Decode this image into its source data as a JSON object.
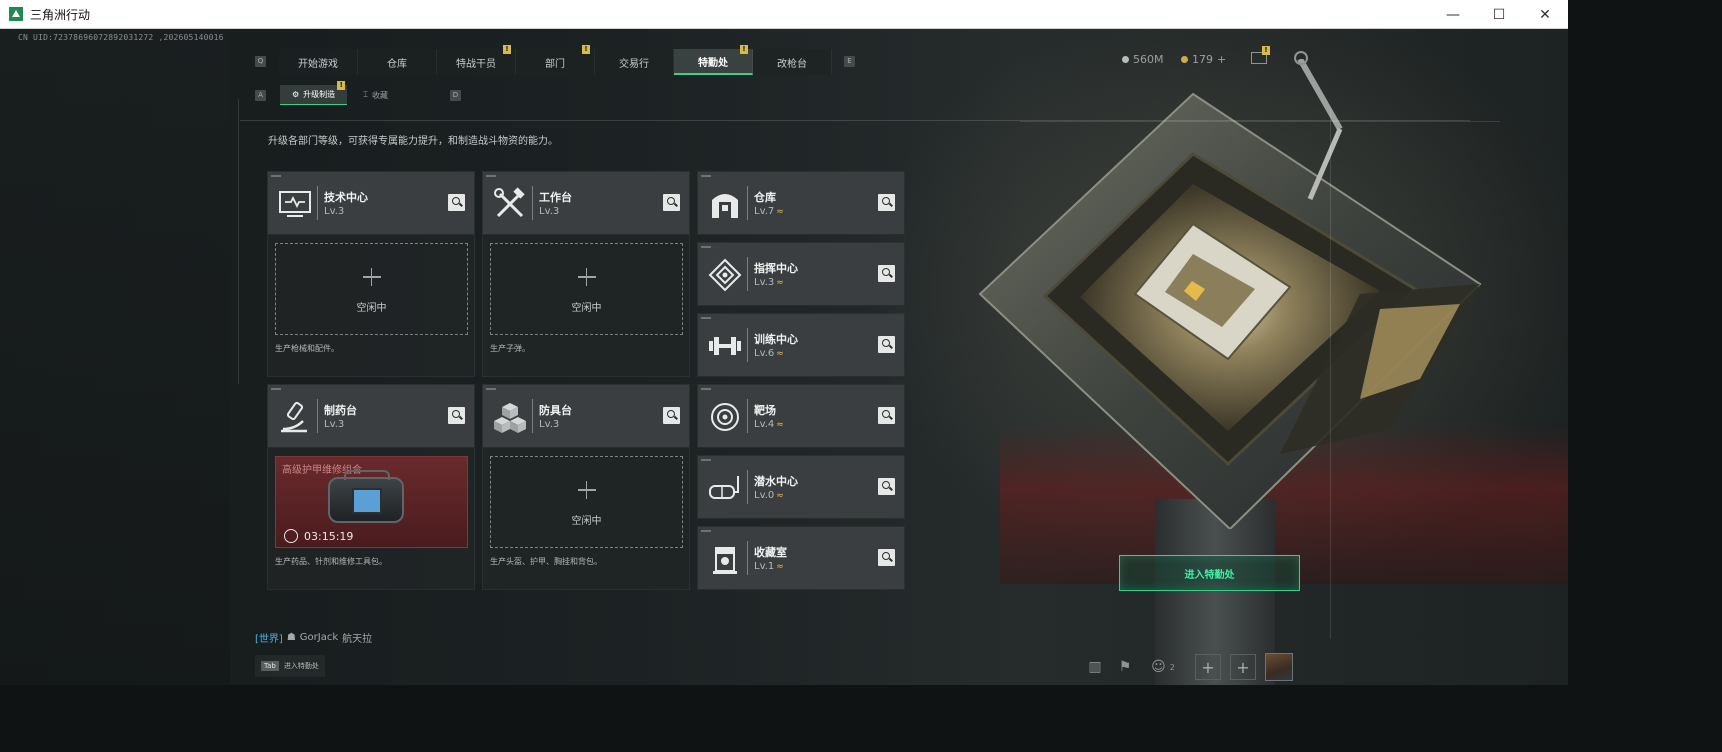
{
  "window": {
    "title": "三角洲行动",
    "minimize": "—",
    "maximize": "☐",
    "close": "✕"
  },
  "uid": "CN UID:7237869607289203127​2 ,202605140016",
  "nav": {
    "key_left": "Q",
    "key_right": "E",
    "tabs": [
      {
        "label": "开始游戏",
        "badge": ""
      },
      {
        "label": "仓库",
        "badge": ""
      },
      {
        "label": "特战干员",
        "badge": "!"
      },
      {
        "label": "部门",
        "badge": "!"
      },
      {
        "label": "交易行",
        "badge": ""
      },
      {
        "label": "特勤处",
        "badge": "!",
        "active": true
      },
      {
        "label": "改枪台",
        "badge": ""
      }
    ]
  },
  "subnav": {
    "key_left": "A",
    "key_right": "D",
    "tabs": [
      {
        "label": "升级制造",
        "badge": "!",
        "active": true
      },
      {
        "label": "收藏",
        "badge": ""
      }
    ]
  },
  "currency": {
    "silver": "560M",
    "gold": "179",
    "gold_plus": "+"
  },
  "subtitle": "升级各部门等级，可获得专属能力提升，和制造战斗物资的能力。",
  "idle_label": "空闲中",
  "production_cards": [
    {
      "name": "技术中心",
      "level": "Lv.3",
      "icon": "computer-icon",
      "desc": "生产枪械和配件。",
      "state": "idle"
    },
    {
      "name": "工作台",
      "level": "Lv.3",
      "icon": "tools-icon",
      "desc": "生产子弹。",
      "state": "idle"
    },
    {
      "name": "制药台",
      "level": "Lv.3",
      "icon": "microscope-icon",
      "desc": "生产药品、针剂和维修工具包。",
      "state": "crafting",
      "craft": {
        "item": "高级护甲维修组合",
        "timer": "03:15:19",
        "icon": "repair-kit-bag"
      }
    },
    {
      "name": "防具台",
      "level": "Lv.3",
      "icon": "armor-blocks-icon",
      "desc": "生产头盔、护甲、胸挂和背包。",
      "state": "idle"
    }
  ],
  "facility_cards": [
    {
      "name": "仓库",
      "level": "Lv.7",
      "upgradable": true,
      "icon": "warehouse-icon"
    },
    {
      "name": "指挥中心",
      "level": "Lv.3",
      "upgradable": true,
      "icon": "command-icon"
    },
    {
      "name": "训练中心",
      "level": "Lv.6",
      "upgradable": true,
      "icon": "dumbbell-icon"
    },
    {
      "name": "靶场",
      "level": "Lv.4",
      "upgradable": true,
      "icon": "target-icon"
    },
    {
      "name": "潜水中心",
      "level": "Lv.0",
      "upgradable": true,
      "icon": "diving-icon"
    },
    {
      "name": "收藏室",
      "level": "Lv.1",
      "upgradable": true,
      "icon": "collection-icon"
    }
  ],
  "upgrade_glyph": "≈",
  "enter_button": "进入特勤处",
  "chat": {
    "channel": "[世界]",
    "user": "GorJack",
    "message": "航天拉"
  },
  "tab_hint": {
    "key": "Tab",
    "label": "进入特勤处"
  },
  "friends_count": "2",
  "colors": {
    "accent": "#39d28a",
    "badge": "#d8b94a",
    "upgrade": "#e0b84a",
    "craft_bg": "#5a2224"
  }
}
